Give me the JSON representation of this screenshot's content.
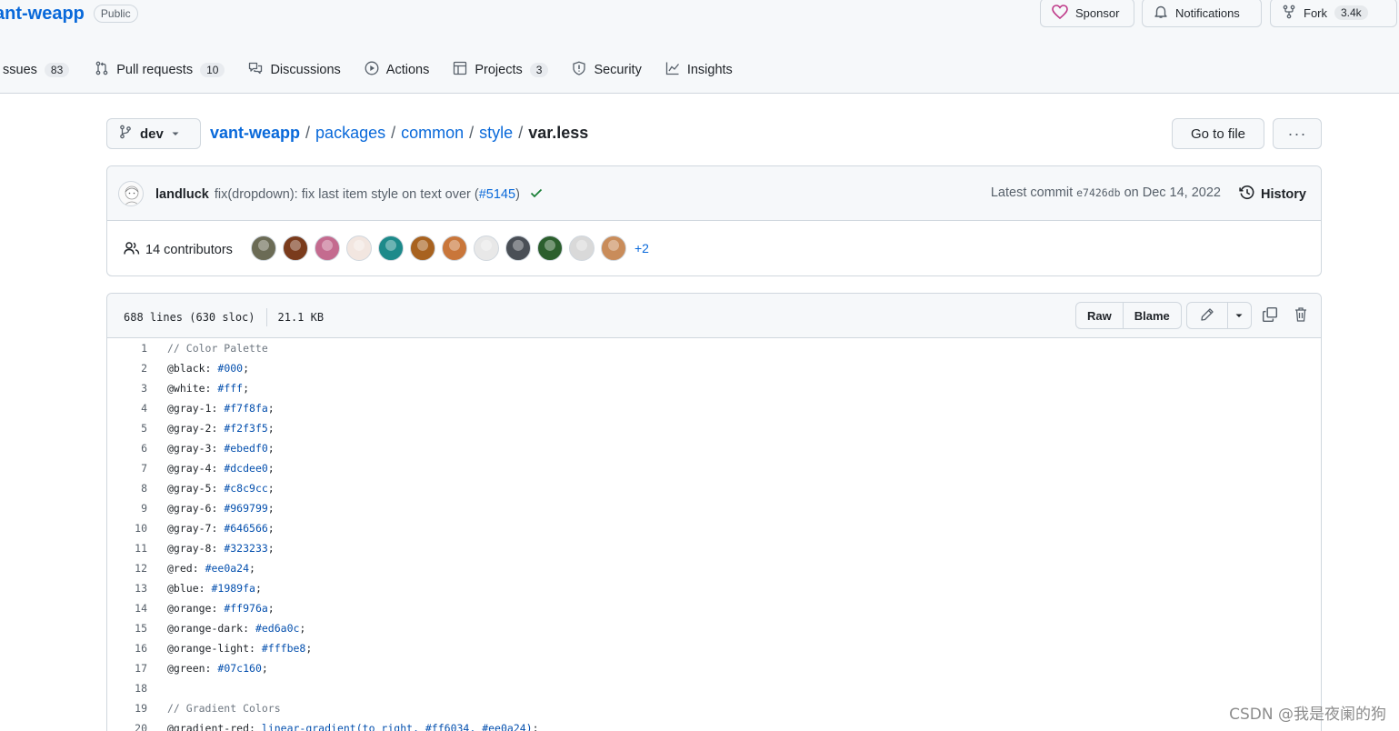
{
  "repo": {
    "name": "ant-weapp",
    "visibility": "Public",
    "sponsor_label": "Sponsor",
    "notifications_label": "Notifications",
    "fork_label": "Fork",
    "fork_count": "3.4k"
  },
  "nav": [
    {
      "label": "ssues",
      "count": "83",
      "icon": "issue-icon"
    },
    {
      "label": "Pull requests",
      "count": "10",
      "icon": "pull-request-icon"
    },
    {
      "label": "Discussions",
      "count": null,
      "icon": "discussions-icon"
    },
    {
      "label": "Actions",
      "count": null,
      "icon": "play-icon"
    },
    {
      "label": "Projects",
      "count": "3",
      "icon": "table-icon"
    },
    {
      "label": "Security",
      "count": null,
      "icon": "shield-icon"
    },
    {
      "label": "Insights",
      "count": null,
      "icon": "graph-icon"
    }
  ],
  "path": {
    "branch": "dev",
    "crumbs": [
      "vant-weapp",
      "packages",
      "common",
      "style"
    ],
    "separator": "/",
    "current": "var.less",
    "go_to_file": "Go to file",
    "more": "···"
  },
  "commit": {
    "author": "landluck",
    "message": "fix(dropdown): fix last item style on text over (",
    "pr": "#5145",
    "message_end": ")",
    "latest_label": "Latest commit",
    "sha": "e7426db",
    "date": "on Dec 14, 2022",
    "history_label": "History",
    "status_color": "#1a7f37"
  },
  "contributors": {
    "label": "14 contributors",
    "more": "+2",
    "avatar_colors": [
      "#6b6b55",
      "#7a3b1c",
      "#c46b8f",
      "#f2e6e0",
      "#1d8a8a",
      "#a8621f",
      "#c9763a",
      "#e8e8e8",
      "#4a4f56",
      "#2c5f2d",
      "#d9d9d9",
      "#c98c5a"
    ]
  },
  "file": {
    "lines_info": "688 lines (630 sloc)",
    "size": "21.1 KB",
    "raw": "Raw",
    "blame": "Blame"
  },
  "code": [
    {
      "n": "1",
      "text": "// Color Palette",
      "type": "comment"
    },
    {
      "n": "2",
      "var": "@black:",
      "val": "#000",
      "end": ";"
    },
    {
      "n": "3",
      "var": "@white:",
      "val": "#fff",
      "end": ";"
    },
    {
      "n": "4",
      "var": "@gray-1:",
      "val": "#f7f8fa",
      "end": ";"
    },
    {
      "n": "5",
      "var": "@gray-2:",
      "val": "#f2f3f5",
      "end": ";"
    },
    {
      "n": "6",
      "var": "@gray-3:",
      "val": "#ebedf0",
      "end": ";"
    },
    {
      "n": "7",
      "var": "@gray-4:",
      "val": "#dcdee0",
      "end": ";"
    },
    {
      "n": "8",
      "var": "@gray-5:",
      "val": "#c8c9cc",
      "end": ";"
    },
    {
      "n": "9",
      "var": "@gray-6:",
      "val": "#969799",
      "end": ";"
    },
    {
      "n": "10",
      "var": "@gray-7:",
      "val": "#646566",
      "end": ";"
    },
    {
      "n": "11",
      "var": "@gray-8:",
      "val": "#323233",
      "end": ";"
    },
    {
      "n": "12",
      "var": "@red:",
      "val": "#ee0a24",
      "end": ";"
    },
    {
      "n": "13",
      "var": "@blue:",
      "val": "#1989fa",
      "end": ";"
    },
    {
      "n": "14",
      "var": "@orange:",
      "val": "#ff976a",
      "end": ";"
    },
    {
      "n": "15",
      "var": "@orange-dark:",
      "val": "#ed6a0c",
      "end": ";"
    },
    {
      "n": "16",
      "var": "@orange-light:",
      "val": "#fffbe8",
      "end": ";"
    },
    {
      "n": "17",
      "var": "@green:",
      "val": "#07c160",
      "end": ";"
    },
    {
      "n": "18",
      "text": "",
      "type": "blank"
    },
    {
      "n": "19",
      "text": "// Gradient Colors",
      "type": "comment"
    },
    {
      "n": "20",
      "var": "@gradient-red:",
      "val": "linear-gradient(to right, #ff6034, #ee0a24)",
      "end": ";"
    }
  ],
  "watermark": "CSDN @我是夜阑的狗"
}
